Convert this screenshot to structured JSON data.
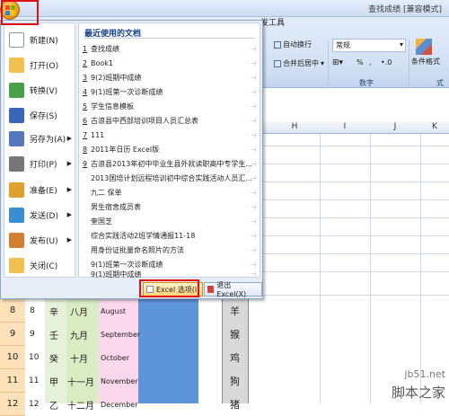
{
  "window": {
    "title": "查找成绩  [兼容模式]"
  },
  "ribbon": {
    "tab_developer": "发工具",
    "wrap_text": "自动换行",
    "merge_center": "合并后居中",
    "number_format": "常规",
    "percent": "%",
    "comma": ",",
    "decimal": "•.0",
    "conditional_format": "条件格式",
    "group_number": "数字",
    "group_styles": "式"
  },
  "menu": {
    "left_items": [
      {
        "label": "新建(N)",
        "icon": "new-doc-icon",
        "color": "#ffffff",
        "has_arrow": false
      },
      {
        "label": "打开(O)",
        "icon": "open-folder-icon",
        "color": "#f0c050",
        "has_arrow": false
      },
      {
        "label": "转换(V)",
        "icon": "convert-icon",
        "color": "#4aa04a",
        "has_arrow": false
      },
      {
        "label": "保存(S)",
        "icon": "save-icon",
        "color": "#3b66b8",
        "has_arrow": false
      },
      {
        "label": "另存为(A)",
        "icon": "save-as-icon",
        "color": "#5577bb",
        "has_arrow": true
      },
      {
        "label": "打印(P)",
        "icon": "print-icon",
        "color": "#777777",
        "has_arrow": true
      },
      {
        "label": "准备(E)",
        "icon": "prepare-icon",
        "color": "#e0a030",
        "has_arrow": true
      },
      {
        "label": "发送(D)",
        "icon": "send-icon",
        "color": "#3a8fd0",
        "has_arrow": true
      },
      {
        "label": "发布(U)",
        "icon": "publish-icon",
        "color": "#d08030",
        "has_arrow": true
      },
      {
        "label": "关闭(C)",
        "icon": "close-doc-icon",
        "color": "#f0c050",
        "has_arrow": false
      }
    ],
    "recent_title": "最近使用的文档",
    "recent": [
      {
        "num": "1",
        "name": "查找成绩"
      },
      {
        "num": "2",
        "name": "Book1"
      },
      {
        "num": "3",
        "name": "9(2)班期中成绩"
      },
      {
        "num": "4",
        "name": "9(1)班第一次诊断成绩"
      },
      {
        "num": "5",
        "name": "学生信息模板"
      },
      {
        "num": "6",
        "name": "古浪县中西部培训项目人员汇总表"
      },
      {
        "num": "7",
        "name": "111"
      },
      {
        "num": "8",
        "name": "2011年日历 Excel版"
      },
      {
        "num": "9",
        "name": "古浪县2013年初中毕业生县外就读职高中专学生..."
      },
      {
        "num": "",
        "name": "2013国培计划远程培训初中综合实践活动人员汇..."
      },
      {
        "num": "",
        "name": "九二 保单"
      },
      {
        "num": "",
        "name": "男生宿舍成员表"
      },
      {
        "num": "",
        "name": "奎国芝"
      },
      {
        "num": "",
        "name": "综合实践活动2班学情通报11-18"
      },
      {
        "num": "",
        "name": "用身份证批量命名照片的方法"
      },
      {
        "num": "",
        "name": "9(1)班第一次诊断成绩"
      },
      {
        "num": "",
        "name": "9(1)班期中成绩"
      }
    ],
    "excel_options": "Excel 选项(I)",
    "exit_excel": "退出 Excel(X)"
  },
  "sheet": {
    "columns": [
      "H",
      "I",
      "J",
      "K"
    ],
    "rows": [
      {
        "row": "8",
        "num": "8",
        "stem": "辛",
        "month_cn": "八月",
        "month_en": "August",
        "zodiac": "羊"
      },
      {
        "row": "9",
        "num": "9",
        "stem": "壬",
        "month_cn": "九月",
        "month_en": "September",
        "zodiac": "猴"
      },
      {
        "row": "10",
        "num": "10",
        "stem": "癸",
        "month_cn": "十月",
        "month_en": "October",
        "zodiac": "鸡"
      },
      {
        "row": "11",
        "num": "11",
        "stem": "甲",
        "month_cn": "十一月",
        "month_en": "November",
        "zodiac": "狗"
      },
      {
        "row": "12",
        "num": "12",
        "stem": "乙",
        "month_cn": "十二月",
        "month_en": "December",
        "zodiac": "猪"
      }
    ]
  },
  "watermark": {
    "line1": "jb51.net",
    "line2": "脚本之家"
  }
}
